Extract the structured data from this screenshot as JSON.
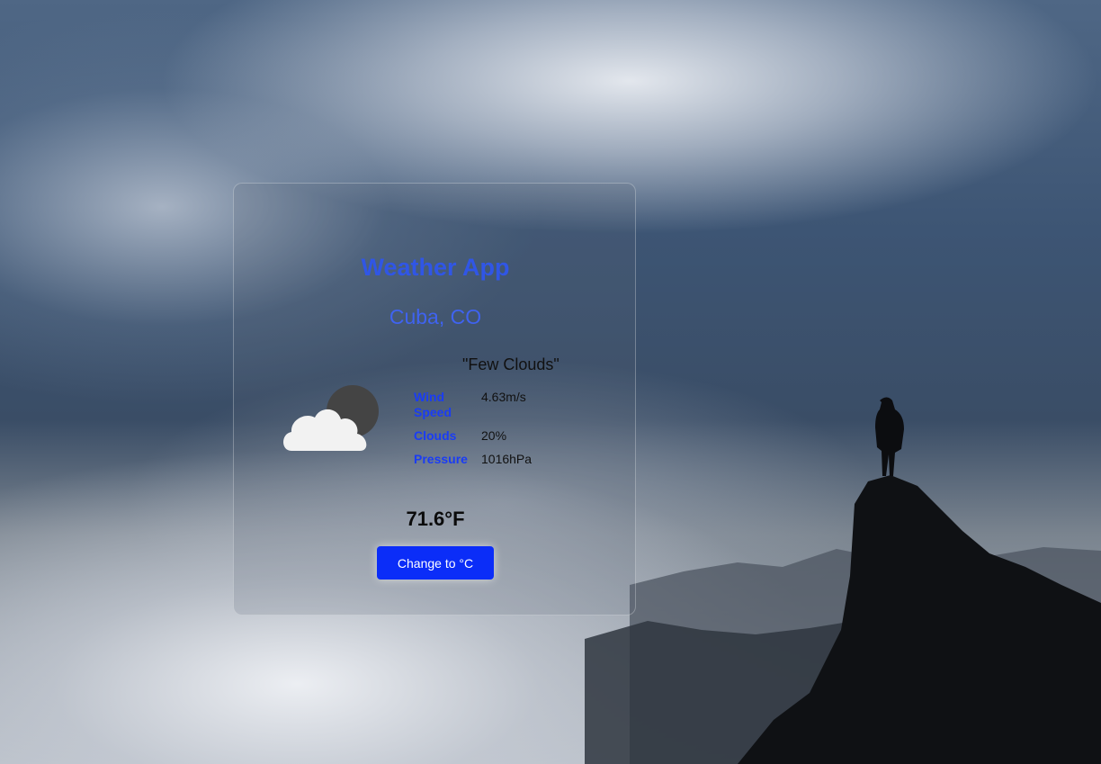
{
  "app": {
    "title": "Weather App",
    "location": "Cuba, CO"
  },
  "weather": {
    "description": "\"Few Clouds\"",
    "icon": "few-clouds-icon",
    "details": [
      {
        "label": "Wind Speed",
        "value": "4.63m/s"
      },
      {
        "label": "Clouds",
        "value": "20%"
      },
      {
        "label": "Pressure",
        "value": "1016hPa"
      }
    ],
    "temperature": "71.6°F"
  },
  "actions": {
    "toggle_unit_label": "Change to °C"
  },
  "colors": {
    "title": "#3056e6",
    "label": "#1a3cf5",
    "button": "#0b2df8"
  }
}
